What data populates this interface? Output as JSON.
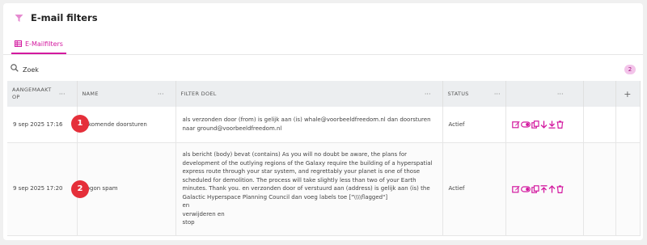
{
  "header": {
    "title": "E-mail filters"
  },
  "tabs": [
    {
      "label": "E-Mailfilters"
    }
  ],
  "search": {
    "value": "Zoek",
    "count": "2"
  },
  "table": {
    "columns": [
      "AANGEMAAKT OP",
      "NAME",
      "FILTER DOEL",
      "STATUS"
    ],
    "rows": [
      {
        "created": "9 sep 2025 17:16",
        "name": "Inkomende doorsturen",
        "doel": "als verzonden door (from) is gelijk aan (is) whale@voorbeeldfreedom.nl dan doorsturen naar ground@voorbeeldfreedom.nl",
        "status": "Actief",
        "marker": "1"
      },
      {
        "created": "9 sep 2025 17:20",
        "name": "Vogon spam",
        "doel_lines": [
          "als bericht (body) bevat (contains) As you will no doubt be aware, the plans for development of the outlying regions of the Galaxy require the building of a hyperspatial express route through your star system, and regrettably your planet is one of those scheduled for demolition. The process will take slightly less than two of your Earth minutes. Thank you. en verzonden door of verstuurd aan (address) is gelijk aan (is) the Galactic Hyperspace Planning Council dan voeg labels toe [\"\\\\\\\\flagged\"]",
          "en",
          "verwijderen en",
          "stop"
        ],
        "status": "Actief",
        "marker": "2"
      }
    ]
  },
  "colors": {
    "accent": "#d3199f",
    "badge": "#e52f3a"
  },
  "icons": [
    "filter-icon",
    "grid-icon",
    "search-icon",
    "edit-icon",
    "toggle-icon",
    "copy-icon",
    "move-down-icon",
    "move-bottom-icon",
    "move-top-icon",
    "move-up-icon",
    "delete-icon"
  ]
}
